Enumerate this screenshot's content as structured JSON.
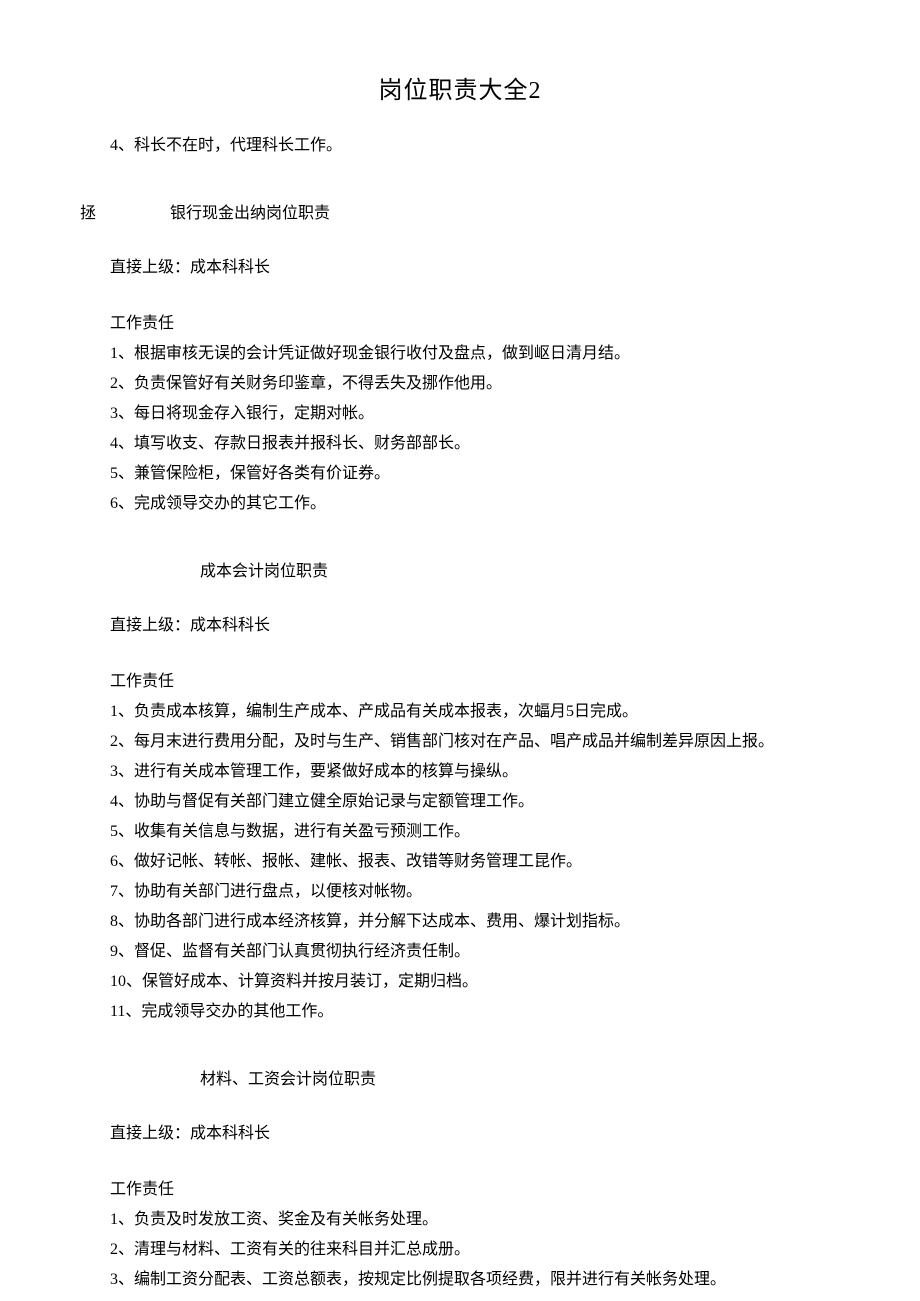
{
  "title": "岗位职责大全2",
  "intro_line": "4、科长不在时，代理科长工作。",
  "section1": {
    "marker": "拯",
    "heading": "银行现金出纳岗位职责",
    "supervisor_label": "直接上级：成本科科长",
    "resp_label": "工作责任",
    "items": {
      "i1": "1、根据审核无误的会计凭证做好现金银行收付及盘点，做到岖日清月结。",
      "i2": "2、负责保管好有关财务印鉴章，不得丢失及挪作他用。",
      "i3": "3、每日将现金存入银行，定期对帐。",
      "i4": "4、填写收支、存款日报表并报科长、财务部部长。",
      "i5": "5、兼管保险柜，保管好各类有价证券。",
      "i6": "6、完成领导交办的其它工作。"
    }
  },
  "section2": {
    "heading": "成本会计岗位职责",
    "supervisor_label": "直接上级：成本科科长",
    "resp_label": "工作责任",
    "items": {
      "i1": "1、负责成本核算，编制生产成本、产成品有关成本报表，次蝠月5日完成。",
      "i2": "2、每月末进行费用分配，及时与生产、销售部门核对在产品、唱产成品并编制差异原因上报。",
      "i3": "3、进行有关成本管理工作，要紧做好成本的核算与操纵。",
      "i4": "4、协助与督促有关部门建立健全原始记录与定额管理工作。",
      "i5": "5、收集有关信息与数据，进行有关盈亏预测工作。",
      "i6": "6、做好记帐、转帐、报帐、建帐、报表、改错等财务管理工昆作。",
      "i7": "7、协助有关部门进行盘点，以便核对帐物。",
      "i8": "8、协助各部门进行成本经济核算，并分解下达成本、费用、爆计划指标。",
      "i9": "9、督促、监督有关部门认真贯彻执行经济责任制。",
      "i10": "10、保管好成本、计算资料并按月装订，定期归档。",
      "i11": "11、完成领导交办的其他工作。"
    }
  },
  "section3": {
    "heading": "材料、工资会计岗位职责",
    "supervisor_label": "直接上级：成本科科长",
    "resp_label": "工作责任",
    "items": {
      "i1": "1、负责及时发放工资、奖金及有关帐务处理。",
      "i2": "2、清理与材料、工资有关的往来科目并汇总成册。",
      "i3": "3、编制工资分配表、工资总额表，按规定比例提取各项经费，限并进行有关帐务处理。"
    }
  }
}
